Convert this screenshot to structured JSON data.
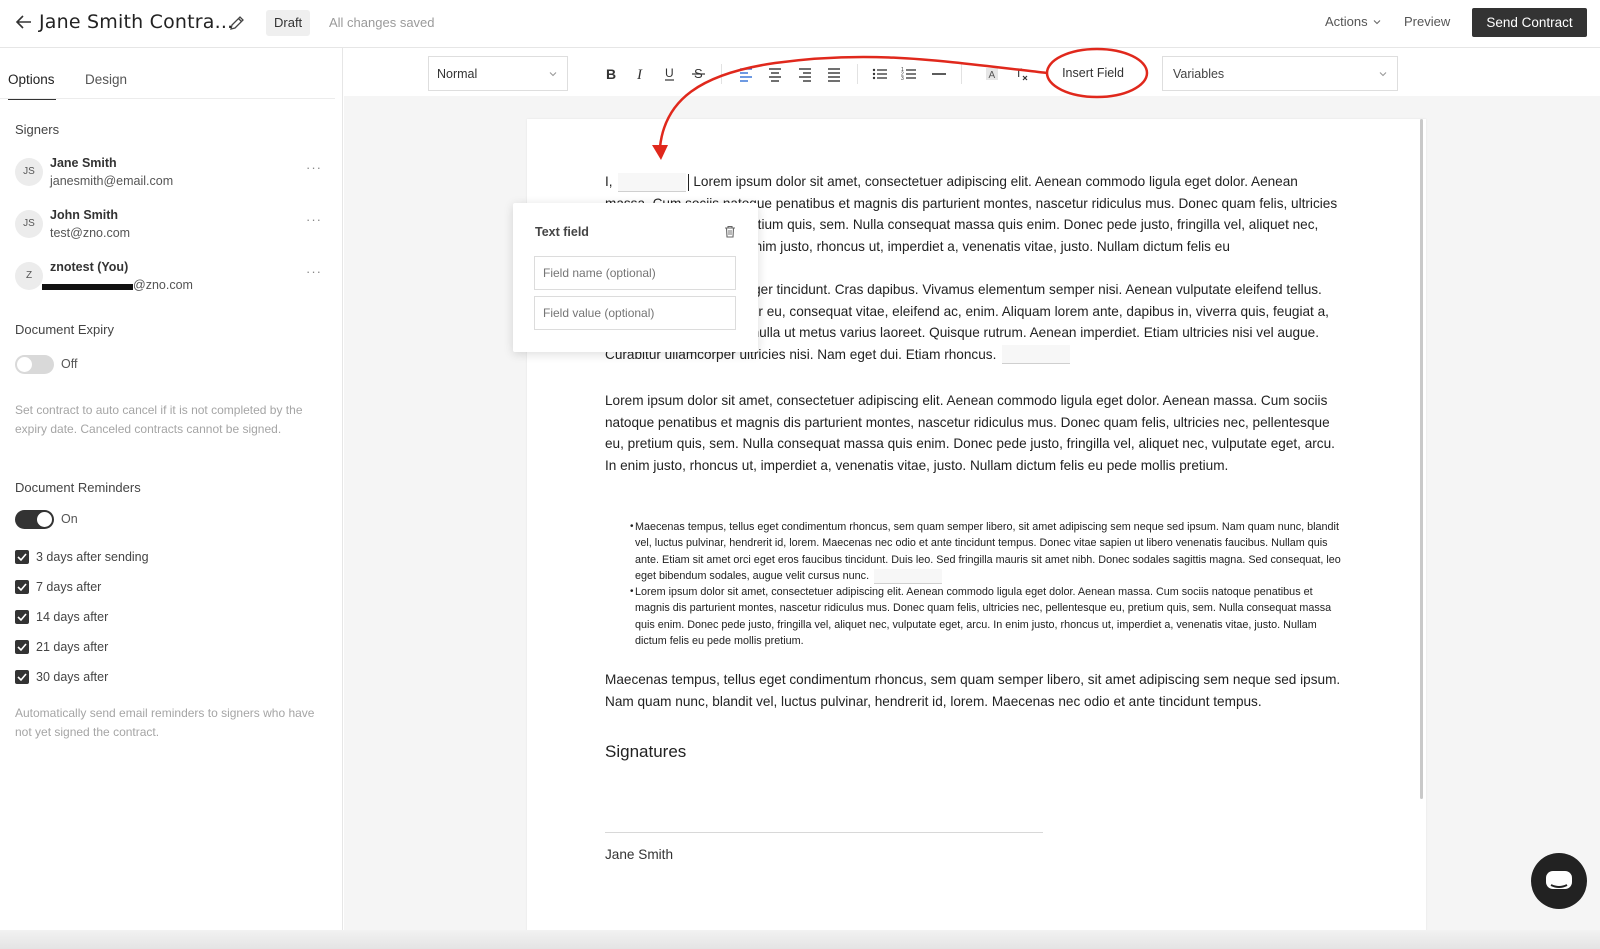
{
  "header": {
    "title": "Jane Smith Contra...",
    "status_badge": "Draft",
    "save_status": "All changes saved",
    "actions_label": "Actions",
    "preview_label": "Preview",
    "send_label": "Send Contract"
  },
  "sidebar": {
    "tabs": [
      "Options",
      "Design"
    ],
    "signers_heading": "Signers",
    "signers": [
      {
        "initials": "JS",
        "name": "Jane Smith",
        "email": "janesmith@email.com"
      },
      {
        "initials": "JS",
        "name": "John Smith",
        "email": "test@zno.com"
      },
      {
        "initials": "Z",
        "name": "znotest (You)",
        "email": "@zno.com"
      }
    ],
    "expiry": {
      "heading": "Document Expiry",
      "toggle_label": "Off",
      "help": "Set contract to auto cancel if it is not completed by the expiry date. Canceled contracts cannot be signed."
    },
    "reminders": {
      "heading": "Document Reminders",
      "toggle_label": "On",
      "options": [
        "3 days after sending",
        "7 days after",
        "14 days after",
        "21 days after",
        "30 days after"
      ],
      "help": "Automatically send email reminders to signers who have not yet signed the contract."
    }
  },
  "toolbar": {
    "text_style": "Normal",
    "insert_field_label": "Insert Field",
    "variables_label": "Variables",
    "annotation_color": "#e0281c"
  },
  "popover": {
    "title": "Text field",
    "name_placeholder": "Field name (optional)",
    "value_placeholder": "Field value (optional)"
  },
  "document": {
    "p1_prefix": "I,",
    "p1_rest": "Lorem ipsum dolor sit amet, consectetuer adipiscing elit. Aenean commodo ligula eget dolor. Aenean massa. Cum sociis natoque penatibus et magnis dis parturient montes, nascetur ridiculus mus. Donec quam felis, ultricies nec, pellentesque eu, pretium quis, sem. Nulla consequat massa quis enim. Donec pede justo, fringilla vel, aliquet nec, vulputate eget, arcu. In enim justo, rhoncus ut, imperdiet a, venenatis vitae, justo. Nullam dictum felis eu",
    "p2": "pede mollis pretium. Integer tincidunt. Cras dapibus. Vivamus elementum semper nisi. Aenean vulputate eleifend tellus. Aenean leo ligula, porttitor eu, consequat vitae, eleifend ac, enim. Aliquam lorem ante, dapibus in, viverra quis, feugiat a, tellus. Phasellus viverra nulla ut metus varius laoreet. Quisque rutrum. Aenean imperdiet. Etiam ultricies nisi vel augue. Curabitur ullamcorper ultricies nisi. Nam eget dui. Etiam rhoncus.",
    "p3": "Lorem ipsum dolor sit amet, consectetuer adipiscing elit. Aenean commodo ligula eget dolor. Aenean massa. Cum sociis natoque penatibus et magnis dis parturient montes, nascetur ridiculus mus. Donec quam felis, ultricies nec, pellentesque eu, pretium quis, sem. Nulla consequat massa quis enim. Donec pede justo, fringilla vel, aliquet nec, vulputate eget, arcu. In enim justo, rhoncus ut, imperdiet a, venenatis vitae, justo. Nullam dictum felis eu pede mollis pretium.",
    "bullets": [
      "Maecenas tempus, tellus eget condimentum rhoncus, sem quam semper libero, sit amet adipiscing sem neque sed ipsum. Nam quam nunc, blandit vel, luctus pulvinar, hendrerit id, lorem. Maecenas nec odio et ante tincidunt tempus. Donec vitae sapien ut libero venenatis faucibus. Nullam quis ante. Etiam sit amet orci eget eros faucibus tincidunt. Duis leo. Sed fringilla mauris sit amet nibh. Donec sodales sagittis magna. Sed consequat, leo eget bibendum sodales, augue velit cursus nunc.",
      "Lorem ipsum dolor sit amet, consectetuer adipiscing elit. Aenean commodo ligula eget dolor. Aenean massa. Cum sociis natoque penatibus et magnis dis parturient montes, nascetur ridiculus mus. Donec quam felis, ultricies nec, pellentesque eu, pretium quis, sem. Nulla consequat massa quis enim. Donec pede justo, fringilla vel, aliquet nec, vulputate eget, arcu. In enim justo, rhoncus ut, imperdiet a, venenatis vitae, justo. Nullam dictum felis eu pede mollis pretium."
    ],
    "p4": "Maecenas tempus, tellus eget condimentum rhoncus, sem quam semper libero, sit amet adipiscing sem neque sed ipsum. Nam quam nunc, blandit vel, luctus pulvinar, hendrerit id, lorem. Maecenas nec odio et ante tincidunt tempus.",
    "signatures_heading": "Signatures",
    "signer_name": "Jane Smith"
  }
}
